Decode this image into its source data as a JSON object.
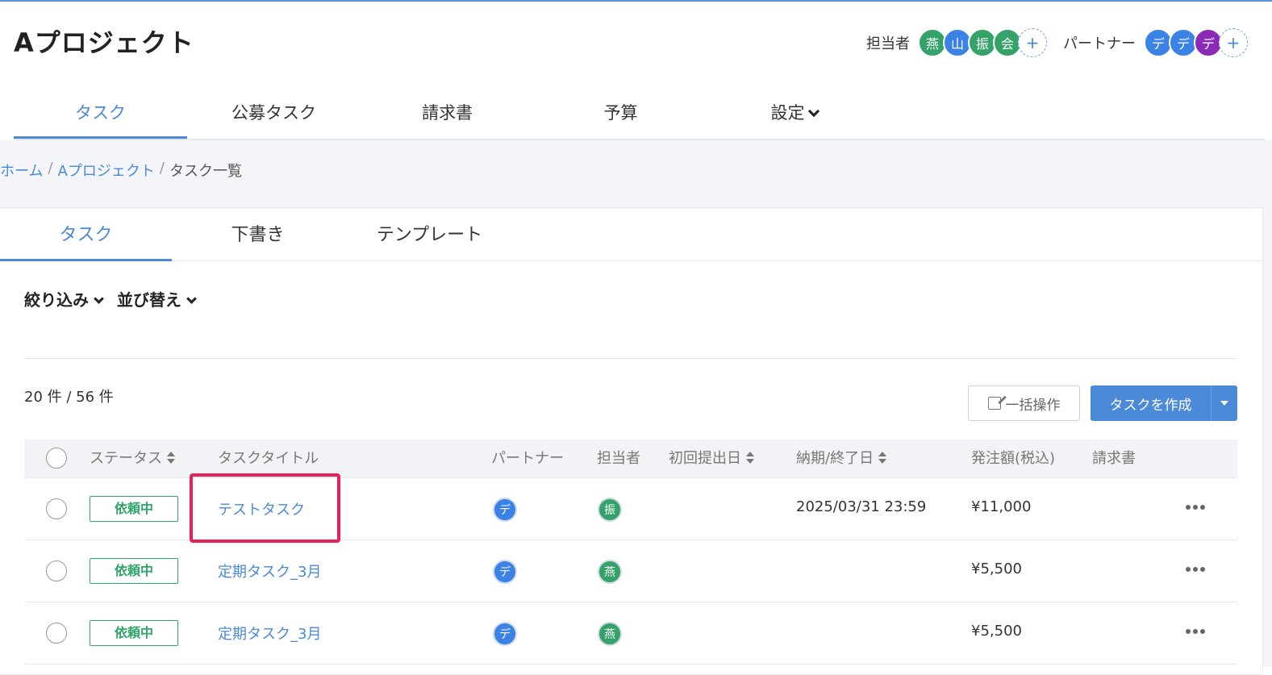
{
  "project": {
    "title": "Aプロジェクト"
  },
  "members": {
    "assignee_label": "担当者",
    "assignees": [
      {
        "initial": "燕",
        "color": "#34a269"
      },
      {
        "initial": "山",
        "color": "#3b82e6"
      },
      {
        "initial": "振",
        "color": "#34a269"
      },
      {
        "initial": "会",
        "color": "#34a269"
      }
    ],
    "partner_label": "パートナー",
    "partners": [
      {
        "initial": "デ",
        "color": "#3b82e6"
      },
      {
        "initial": "デ",
        "color": "#3b82e6"
      },
      {
        "initial": "デ",
        "color": "#8b2ab7"
      }
    ],
    "add_symbol": "+"
  },
  "main_nav": {
    "tabs": [
      {
        "label": "タスク",
        "active": true
      },
      {
        "label": "公募タスク",
        "active": false
      },
      {
        "label": "請求書",
        "active": false
      },
      {
        "label": "予算",
        "active": false
      },
      {
        "label": "設定",
        "active": false
      }
    ]
  },
  "breadcrumb": {
    "items": [
      "ホーム",
      "Aプロジェクト",
      "タスク一覧"
    ],
    "separator": "/"
  },
  "sub_tabs": {
    "tabs": [
      {
        "label": "タスク",
        "active": true
      },
      {
        "label": "下書き",
        "active": false
      },
      {
        "label": "テンプレート",
        "active": false
      }
    ]
  },
  "filters": {
    "filter_label": "絞り込み",
    "sort_label": "並び替え"
  },
  "list": {
    "count_text": "20 件 / 56 件"
  },
  "actions": {
    "bulk_label": "一括操作",
    "create_label": "タスクを作成"
  },
  "table": {
    "headers": {
      "status": "ステータス",
      "title": "タスクタイトル",
      "partner": "パートナー",
      "assignee": "担当者",
      "first_submit": "初回提出日",
      "due": "納期/終了日",
      "amount": "発注額(税込)",
      "invoice": "請求書"
    },
    "rows": [
      {
        "status": "依頼中",
        "title": "テストタスク",
        "partner": "デ",
        "assignee": "振",
        "first_submit": "",
        "due": "2025/03/31 23:59",
        "amount": "¥11,000",
        "invoice": ""
      },
      {
        "status": "依頼中",
        "title": "定期タスク_3月",
        "partner": "デ",
        "assignee": "燕",
        "first_submit": "",
        "due": "",
        "amount": "¥5,500",
        "invoice": ""
      },
      {
        "status": "依頼中",
        "title": "定期タスク_3月",
        "partner": "デ",
        "assignee": "燕",
        "first_submit": "",
        "due": "",
        "amount": "¥5,500",
        "invoice": ""
      }
    ]
  },
  "colors": {
    "accent": "#4a8ad8",
    "status_green": "#2ea56a",
    "highlight": "#e8205a"
  }
}
